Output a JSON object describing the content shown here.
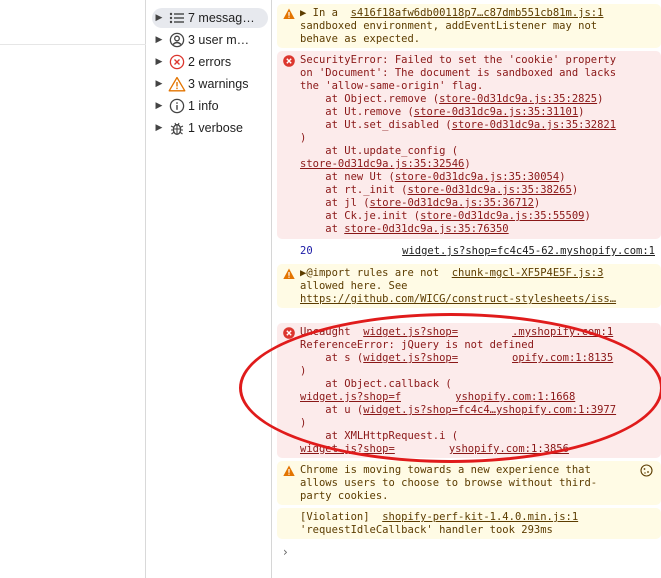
{
  "sidebar": {
    "items": [
      {
        "label": "7 messag…",
        "icon": "list-icon"
      },
      {
        "label": "3 user m…",
        "icon": "user-circle-icon"
      },
      {
        "label": "2 errors",
        "icon": "error-circle-icon"
      },
      {
        "label": "3 warnings",
        "icon": "warning-triangle-icon"
      },
      {
        "label": "1 info",
        "icon": "info-circle-icon"
      },
      {
        "label": "1 verbose",
        "icon": "bug-icon"
      }
    ]
  },
  "console": {
    "m1": {
      "l1a": "▶ In a  ",
      "src": "s416f18afw6db00118p7…c87dmb551cb81m.js:1",
      "l2": "sandboxed environment, addEventListener may not",
      "l3": "behave as expected."
    },
    "m2": {
      "l1": "SecurityError: Failed to set the 'cookie' property",
      "l2": "on 'Document': The document is sandboxed and lacks",
      "l3": "the 'allow-same-origin' flag.",
      "f1a": "    at Object.remove (",
      "f1b": "store-0d31dc9a.js:35:2825",
      "f2a": "    at Ut.remove (",
      "f2b": "store-0d31dc9a.js:35:31101",
      "f3a": "    at Ut.set_disabled (",
      "f3b": "store-0d31dc9a.js:35:32821",
      "f3c": ")",
      "f4a": "    at Ut.update_config (",
      "f4b": "store-0d31dc9a.js:35:32546",
      "f4c": ")",
      "f5a": "    at new Ut (",
      "f5b": "store-0d31dc9a.js:35:30054",
      "f6a": "    at rt._init (",
      "f6b": "store-0d31dc9a.js:35:38265",
      "f7a": "    at jl (",
      "f7b": "store-0d31dc9a.js:35:36712",
      "f8a": "    at Ck.je.init (",
      "f8b": "store-0d31dc9a.js:35:55509",
      "f9a": "    at ",
      "f9b": "store-0d31dc9a.js:35:76350"
    },
    "m3": {
      "count": "20",
      "src": "widget.js?shop=fc4c45-62.myshopify.com:1"
    },
    "m4": {
      "l1a": "▶@import rules are not  ",
      "src": "chunk-mgcl-XF5P4E5F.js:3",
      "l2": "allowed here. See",
      "l3": "https://github.com/WICG/construct-stylesheets/iss…"
    },
    "m5": {
      "l1a": "Uncaught  ",
      "srcA": "widget.js?shop=",
      "srcB": ".myshopify.com:1",
      "l2": "ReferenceError: jQuery is not defined",
      "f1a": "    at s (",
      "f1b": "widget.js?shop=",
      "f1c": "opify.com:1:8135",
      "f1d": ")",
      "f2a": "    at Object.callback (",
      "f2b": "widget.js?shop=f",
      "f2c": "yshopify.com:1:1668",
      "f2d": ")",
      "f3a": "    at u (",
      "f3b": "widget.js?shop=fc4c4…yshopify.com:1:3977",
      "f3c": ")",
      "f4a": "    at XMLHttpRequest.i (",
      "f4b": "widget.js?shop=",
      "f4c": "yshopify.com:1:3856",
      "f4d": ")"
    },
    "m6": {
      "l1": "Chrome is moving towards a new experience that",
      "l2": "allows users to choose to browse without third-",
      "l3": "party cookies."
    },
    "m7": {
      "l1a": "[Violation]  ",
      "src": "shopify-perf-kit-1.4.0.min.js:1",
      "l2": "'requestIdleCallback' handler took 293ms"
    },
    "prompt": "›"
  },
  "colors": {
    "warning_bg": "#fffbe5",
    "error_bg": "#fcebeb",
    "annotation": "#e01b1b"
  }
}
